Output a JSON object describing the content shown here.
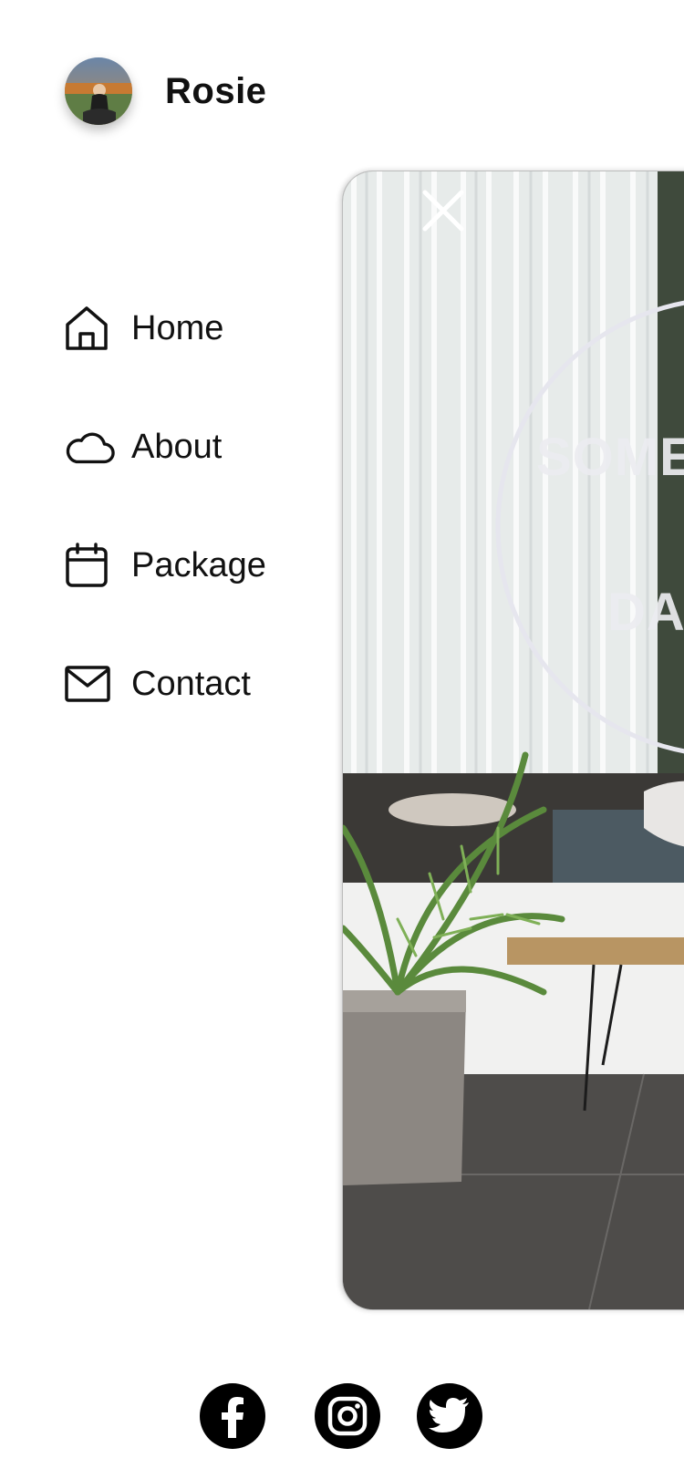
{
  "profile": {
    "name": "Rosie"
  },
  "menu": {
    "items": [
      {
        "label": "Home",
        "icon": "home-icon"
      },
      {
        "label": "About",
        "icon": "cloud-icon"
      },
      {
        "label": "Package",
        "icon": "calendar-icon"
      },
      {
        "label": "Contact",
        "icon": "mail-icon"
      }
    ]
  },
  "preview": {
    "sign_line1": "SOME",
    "sign_line2": "DA"
  },
  "social": [
    "facebook-icon",
    "instagram-icon",
    "twitter-icon"
  ]
}
